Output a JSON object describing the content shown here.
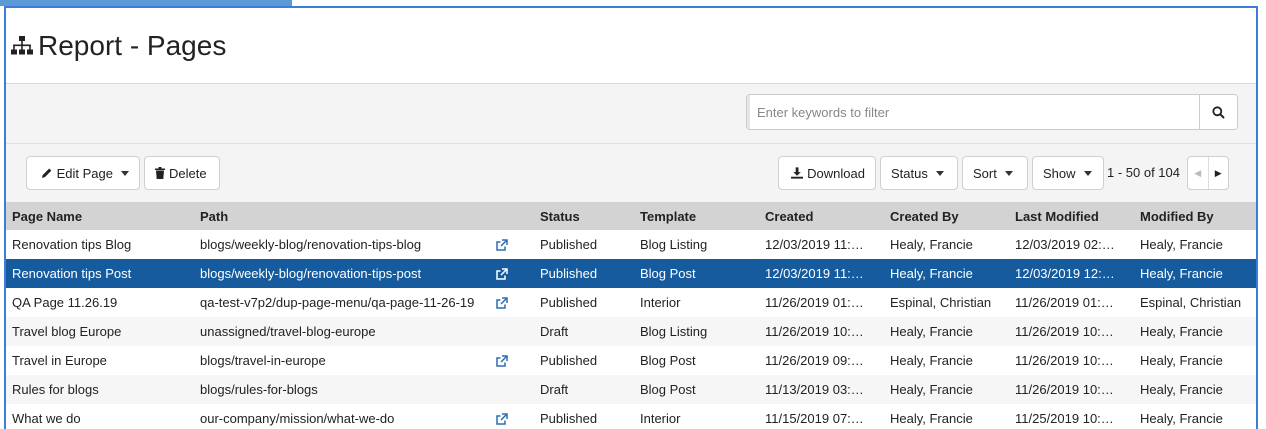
{
  "page": {
    "title": "Report - Pages"
  },
  "filter": {
    "placeholder": "Enter keywords to filter"
  },
  "toolbar": {
    "edit_label": "Edit Page",
    "delete_label": "Delete",
    "download_label": "Download",
    "status_label": "Status",
    "sort_label": "Sort",
    "show_label": "Show",
    "pager_text": "1 - 50 of 104"
  },
  "table": {
    "columns": [
      "Page Name",
      "Path",
      "Status",
      "Template",
      "Created",
      "Created By",
      "Last Modified",
      "Modified By"
    ],
    "rows": [
      {
        "name": "Renovation tips Blog",
        "path": "blogs/weekly-blog/renovation-tips-blog",
        "external": true,
        "status": "Published",
        "template": "Blog Listing",
        "created": "12/03/2019 11:…",
        "created_by": "Healy, Francie",
        "modified": "12/03/2019 02:…",
        "modified_by": "Healy, Francie"
      },
      {
        "name": "Renovation tips Post",
        "path": "blogs/weekly-blog/renovation-tips-post",
        "external": true,
        "status": "Published",
        "template": "Blog Post",
        "created": "12/03/2019 11:…",
        "created_by": "Healy, Francie",
        "modified": "12/03/2019 12:…",
        "modified_by": "Healy, Francie",
        "selected": true
      },
      {
        "name": "QA Page 11.26.19",
        "path": "qa-test-v7p2/dup-page-menu/qa-page-11-26-19",
        "external": true,
        "status": "Published",
        "template": "Interior",
        "created": "11/26/2019 01:…",
        "created_by": "Espinal, Christian",
        "modified": "11/26/2019 01:…",
        "modified_by": "Espinal, Christian"
      },
      {
        "name": "Travel blog Europe",
        "path": "unassigned/travel-blog-europe",
        "external": false,
        "status": "Draft",
        "template": "Blog Listing",
        "created": "11/26/2019 10:…",
        "created_by": "Healy, Francie",
        "modified": "11/26/2019 10:…",
        "modified_by": "Healy, Francie"
      },
      {
        "name": "Travel in Europe",
        "path": "blogs/travel-in-europe",
        "external": true,
        "status": "Published",
        "template": "Blog Post",
        "created": "11/26/2019 09:…",
        "created_by": "Healy, Francie",
        "modified": "11/26/2019 10:…",
        "modified_by": "Healy, Francie"
      },
      {
        "name": "Rules for blogs",
        "path": "blogs/rules-for-blogs",
        "external": false,
        "status": "Draft",
        "template": "Blog Post",
        "created": "11/13/2019 03:…",
        "created_by": "Healy, Francie",
        "modified": "11/26/2019 10:…",
        "modified_by": "Healy, Francie"
      },
      {
        "name": "What we do",
        "path": "our-company/mission/what-we-do",
        "external": true,
        "status": "Published",
        "template": "Interior",
        "created": "11/15/2019 07:…",
        "created_by": "Healy, Francie",
        "modified": "11/25/2019 10:…",
        "modified_by": "Healy, Francie"
      }
    ]
  },
  "colors": {
    "accent": "#3b7dd8",
    "selected_row": "#155b9e",
    "header_bg": "#d3d3d3",
    "link_icon": "#2a6db5"
  },
  "icons": {
    "title": "sitemap-icon",
    "search": "search-icon",
    "edit": "pencil-icon",
    "delete": "trash-icon",
    "download": "download-icon",
    "external": "external-link-icon"
  }
}
